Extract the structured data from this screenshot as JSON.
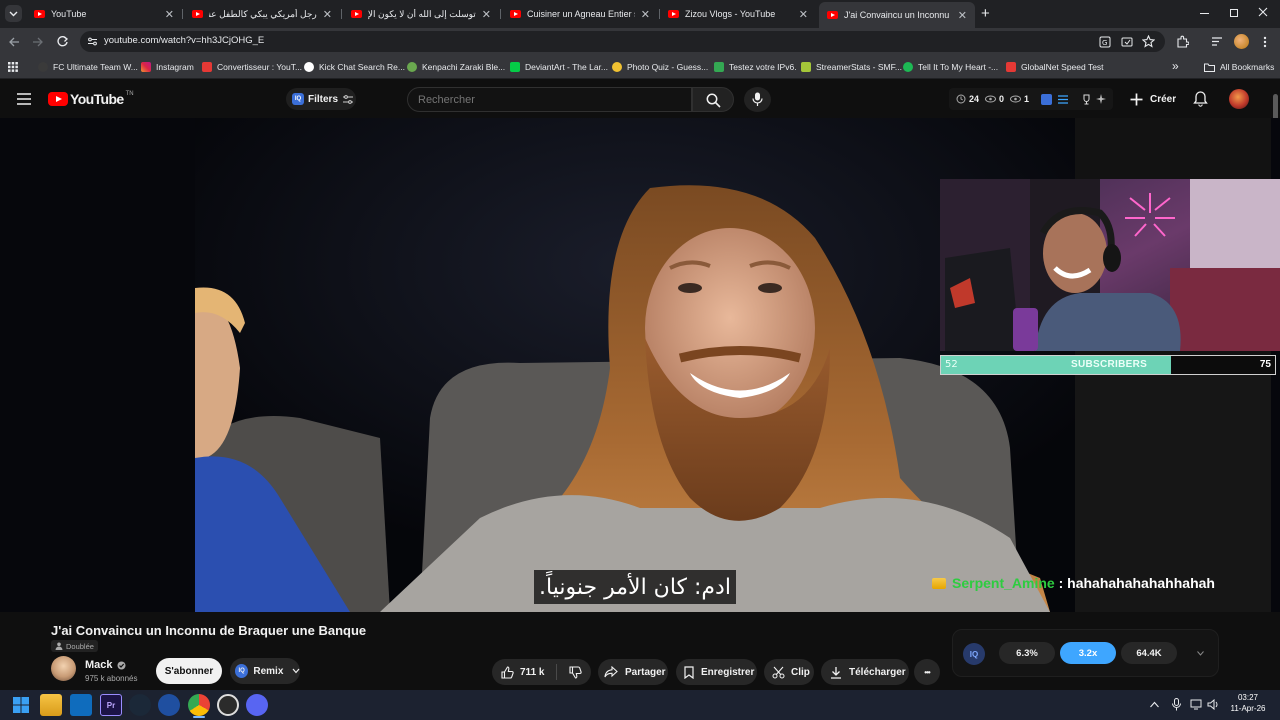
{
  "browser": {
    "tabs": [
      {
        "title": "YouTube",
        "close": "✕"
      },
      {
        "title": "رجل أمريكي يبكي كالطفل عندما",
        "close": "✕"
      },
      {
        "title": "توسلت إلى الله أن لا يكون الإسلا\"",
        "close": "✕"
      },
      {
        "title": "Cuisiner un Agneau Entier sous",
        "close": "✕"
      },
      {
        "title": "Zizou Vlogs - YouTube",
        "close": "✕"
      },
      {
        "title": "J'ai Convaincu un Inconnu de B",
        "close": "✕"
      }
    ],
    "new_tab": "+",
    "url": "youtube.com/watch?v=hh3JCjOHG_E",
    "bookmarks": [
      {
        "label": "FC Ultimate Team W...",
        "color": "#3a3a3a"
      },
      {
        "label": "Instagram",
        "color": "#d6249f"
      },
      {
        "label": "Convertisseur : YouT...",
        "color": "#e53935"
      },
      {
        "label": "Kick Chat Search Re...",
        "color": "#ffffff"
      },
      {
        "label": "Kenpachi Zaraki Ble...",
        "color": "#6aa84f"
      },
      {
        "label": "DeviantArt - The Lar...",
        "color": "#05cc47"
      },
      {
        "label": "Photo Quiz - Guess...",
        "color": "#f1c232"
      },
      {
        "label": "Testez votre IPv6.",
        "color": "#34a853"
      },
      {
        "label": "StreamerStats - SMF...",
        "color": "#a4c639"
      },
      {
        "label": "Tell It To My Heart -...",
        "color": "#1db954"
      },
      {
        "label": "GlobalNet Speed Test",
        "color": "#e53935"
      }
    ],
    "bookmarks_more": "»",
    "all_bookmarks": "All Bookmarks"
  },
  "youtube": {
    "logo_text": "YouTube",
    "logo_suffix": "TN",
    "filters_badge": "IQ",
    "filters_label": "Filters",
    "search_placeholder": "Rechercher",
    "stats": {
      "clock": "24",
      "views": "0",
      "eye": "1"
    },
    "create_label": "Créer"
  },
  "video": {
    "subtitle": "ادم: كان الأمر جنونياً.",
    "chat_user": "Serpent_Amine",
    "chat_sep": " : ",
    "chat_message": "hahahahahahahhahah",
    "sub_bar": {
      "left": "52",
      "label": "SUBSCRIBERS",
      "right": "75",
      "fill": 0.69
    }
  },
  "meta": {
    "title": "J'ai Convaincu un Inconnu de Braquer une Banque",
    "dubbed": "Doublée",
    "channel": "Mack",
    "subscribers": "975 k abonnés",
    "subscribe": "S'abonner",
    "remix_badge": "IQ",
    "remix": "Remix",
    "likes": "711 k",
    "share": "Partager",
    "save": "Enregistrer",
    "clip": "Clip",
    "download": "Télécharger",
    "more": "•••"
  },
  "iq_panel": {
    "badge": "IQ",
    "values": [
      "6.3%",
      "3.2x",
      "64.4K"
    ],
    "highlight_color": "#3ea6ff"
  },
  "taskbar": {
    "time": "03:27",
    "date": "11-Apr-26"
  }
}
